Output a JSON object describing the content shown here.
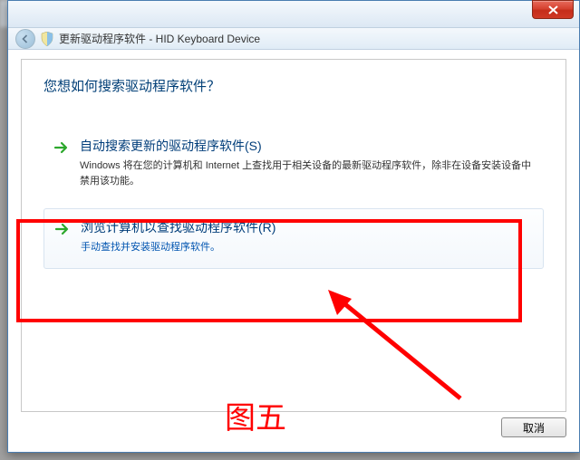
{
  "window": {
    "title": "更新驱动程序软件 - HID Keyboard Device"
  },
  "heading": "您想如何搜索驱动程序软件？",
  "options": [
    {
      "title": "自动搜索更新的驱动程序软件(S)",
      "desc": "Windows 将在您的计算机和 Internet 上查找用于相关设备的最新驱动程序软件，除非在设备安装设备中禁用该功能。"
    },
    {
      "title": "浏览计算机以查找驱动程序软件(R)",
      "desc": "手动查找并安装驱动程序软件。"
    }
  ],
  "footer": {
    "cancel": "取消"
  },
  "annotation": {
    "caption": "图五"
  }
}
